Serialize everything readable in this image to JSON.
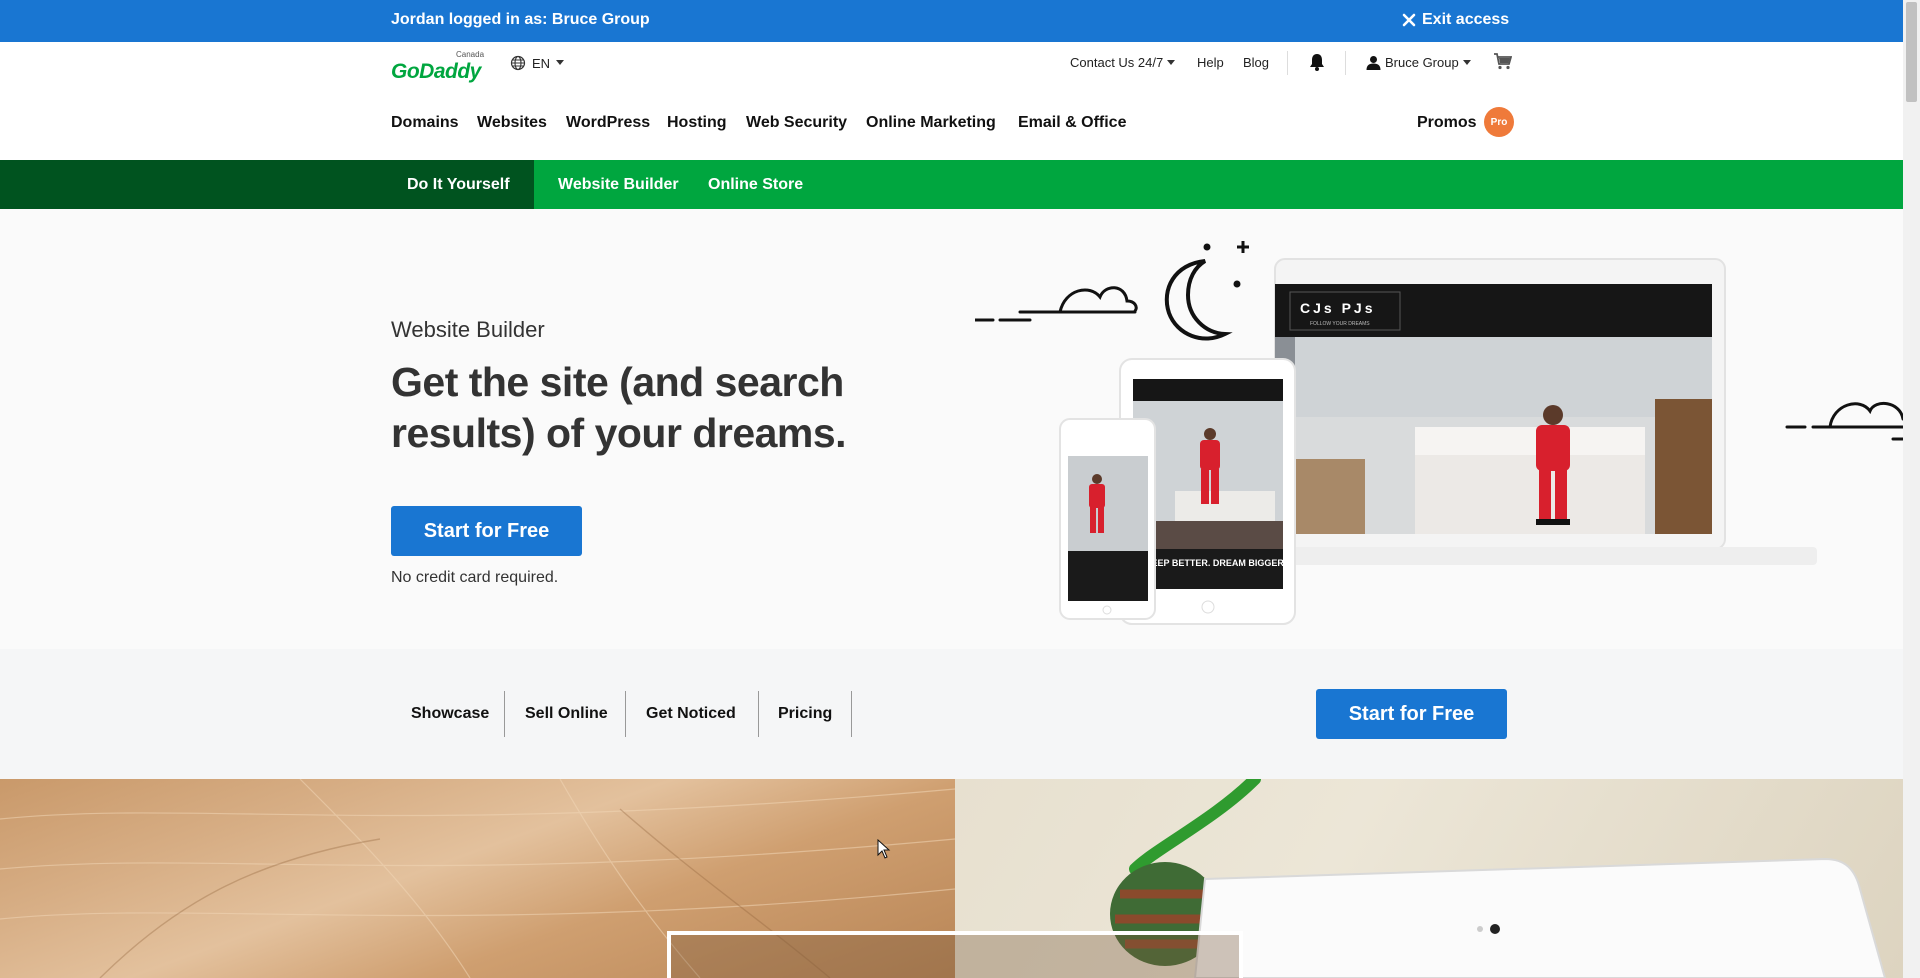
{
  "impersonation": {
    "message": "Jordan logged in as: Bruce Group",
    "exit_label": "Exit access"
  },
  "utility": {
    "logo_text": "GoDaddy",
    "logo_region": "Canada",
    "language": "EN",
    "contact": "Contact Us 24/7",
    "help": "Help",
    "blog": "Blog",
    "account_name": "Bruce Group"
  },
  "main_nav": {
    "items": [
      "Domains",
      "Websites",
      "WordPress",
      "Hosting",
      "Web Security",
      "Online Marketing",
      "Email & Office"
    ],
    "promos": "Promos",
    "pro_badge": "Pro"
  },
  "sub_nav": {
    "section": "Do It Yourself",
    "items": [
      "Website Builder",
      "Online Store"
    ],
    "active": "Website Builder"
  },
  "hero": {
    "kicker": "Website Builder",
    "headline": "Get the site (and search results) of your dreams.",
    "cta": "Start for Free",
    "note": "No credit card required.",
    "mock_brand": "CJs PJs",
    "mock_tagline": "FOLLOW YOUR DREAMS",
    "mock_banner": "SLEEP BETTER. DREAM BIGGER."
  },
  "section_tabs": {
    "items": [
      "Showcase",
      "Sell Online",
      "Get Noticed",
      "Pricing"
    ],
    "cta": "Start for Free"
  },
  "colors": {
    "brand_blue": "#1976d2",
    "brand_green": "#00a63f",
    "dark_green": "#00531f",
    "pro_orange": "#ef7a3a"
  }
}
